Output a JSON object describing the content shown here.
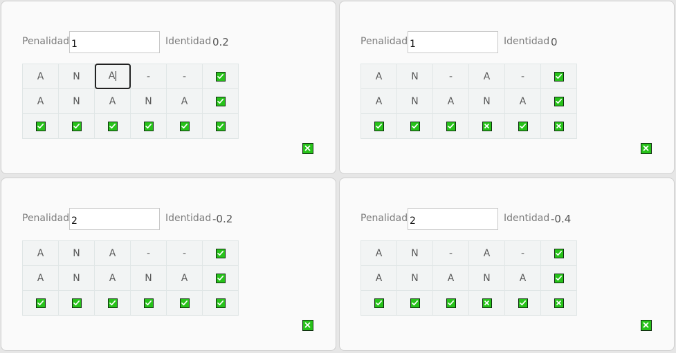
{
  "labels": {
    "penalty": "Penalidad",
    "identity": "Identidad"
  },
  "panels": [
    {
      "penalty_value": "1",
      "identity_value": "0.2",
      "rows": [
        [
          {
            "text": "A"
          },
          {
            "text": "N"
          },
          {
            "text": "A"
          },
          {
            "text": "-"
          },
          {
            "text": "-"
          },
          {
            "icon": "check"
          }
        ],
        [
          {
            "text": "A"
          },
          {
            "text": "N"
          },
          {
            "text": "A"
          },
          {
            "text": "N"
          },
          {
            "text": "A"
          },
          {
            "icon": "check"
          }
        ],
        [
          {
            "icon": "check"
          },
          {
            "icon": "check"
          },
          {
            "icon": "check"
          },
          {
            "icon": "check"
          },
          {
            "icon": "check"
          },
          {
            "icon": "check"
          }
        ]
      ]
    },
    {
      "penalty_value": "1",
      "identity_value": "0",
      "rows": [
        [
          {
            "text": "A"
          },
          {
            "text": "N"
          },
          {
            "text": "-"
          },
          {
            "text": "A"
          },
          {
            "text": "-"
          },
          {
            "icon": "check"
          }
        ],
        [
          {
            "text": "A"
          },
          {
            "text": "N"
          },
          {
            "text": "A"
          },
          {
            "text": "N"
          },
          {
            "text": "A"
          },
          {
            "icon": "check"
          }
        ],
        [
          {
            "icon": "check"
          },
          {
            "icon": "check"
          },
          {
            "icon": "check"
          },
          {
            "icon": "cross"
          },
          {
            "icon": "check"
          },
          {
            "icon": "cross"
          }
        ]
      ]
    },
    {
      "penalty_value": "2",
      "identity_value": "-0.2",
      "rows": [
        [
          {
            "text": "A"
          },
          {
            "text": "N"
          },
          {
            "text": "A"
          },
          {
            "text": "-"
          },
          {
            "text": "-"
          },
          {
            "icon": "check"
          }
        ],
        [
          {
            "text": "A"
          },
          {
            "text": "N"
          },
          {
            "text": "A"
          },
          {
            "text": "N"
          },
          {
            "text": "A"
          },
          {
            "icon": "check"
          }
        ],
        [
          {
            "icon": "check"
          },
          {
            "icon": "check"
          },
          {
            "icon": "check"
          },
          {
            "icon": "check"
          },
          {
            "icon": "check"
          },
          {
            "icon": "check"
          }
        ]
      ]
    },
    {
      "penalty_value": "2",
      "identity_value": "-0.4",
      "rows": [
        [
          {
            "text": "A"
          },
          {
            "text": "N"
          },
          {
            "text": "-"
          },
          {
            "text": "A"
          },
          {
            "text": "-"
          },
          {
            "icon": "check"
          }
        ],
        [
          {
            "text": "A"
          },
          {
            "text": "N"
          },
          {
            "text": "A"
          },
          {
            "text": "N"
          },
          {
            "text": "A"
          },
          {
            "icon": "check"
          }
        ],
        [
          {
            "icon": "check"
          },
          {
            "icon": "check"
          },
          {
            "icon": "check"
          },
          {
            "icon": "cross"
          },
          {
            "icon": "check"
          },
          {
            "icon": "cross"
          }
        ]
      ]
    }
  ],
  "selected_cell": {
    "panel": 0,
    "row": 0,
    "col": 2
  },
  "colors": {
    "checkbox_fill": "#27c21a",
    "checkbox_border": "#0f2c0f",
    "cell_bg": "#f2f4f4"
  }
}
